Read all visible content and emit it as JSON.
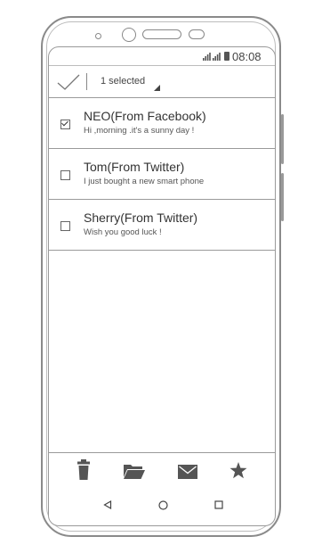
{
  "status_bar": {
    "time": "08:08",
    "icons": [
      "signal-icon",
      "signal-icon",
      "battery-icon"
    ]
  },
  "header": {
    "selected_label": "1 selected",
    "icons": [
      "checkmark-icon",
      "dropdown-triangle-icon"
    ]
  },
  "messages": [
    {
      "sender": "NEO(From Facebook)",
      "preview": "Hi ,morning .it's a sunny day !",
      "checked": true
    },
    {
      "sender": "Tom(From Twitter)",
      "preview": "I just bought a new smart phone",
      "checked": false
    },
    {
      "sender": "Sherry(From Twitter)",
      "preview": "Wish you good luck !",
      "checked": false
    }
  ],
  "action_bar": [
    "trash-icon",
    "folder-icon",
    "mail-icon",
    "star-icon"
  ],
  "nav_bar": [
    "back-icon",
    "home-icon",
    "recent-apps-icon"
  ],
  "colors": {
    "icon": "#555555",
    "divider": "#9a9a9a",
    "frame": "#8a8a8a"
  }
}
